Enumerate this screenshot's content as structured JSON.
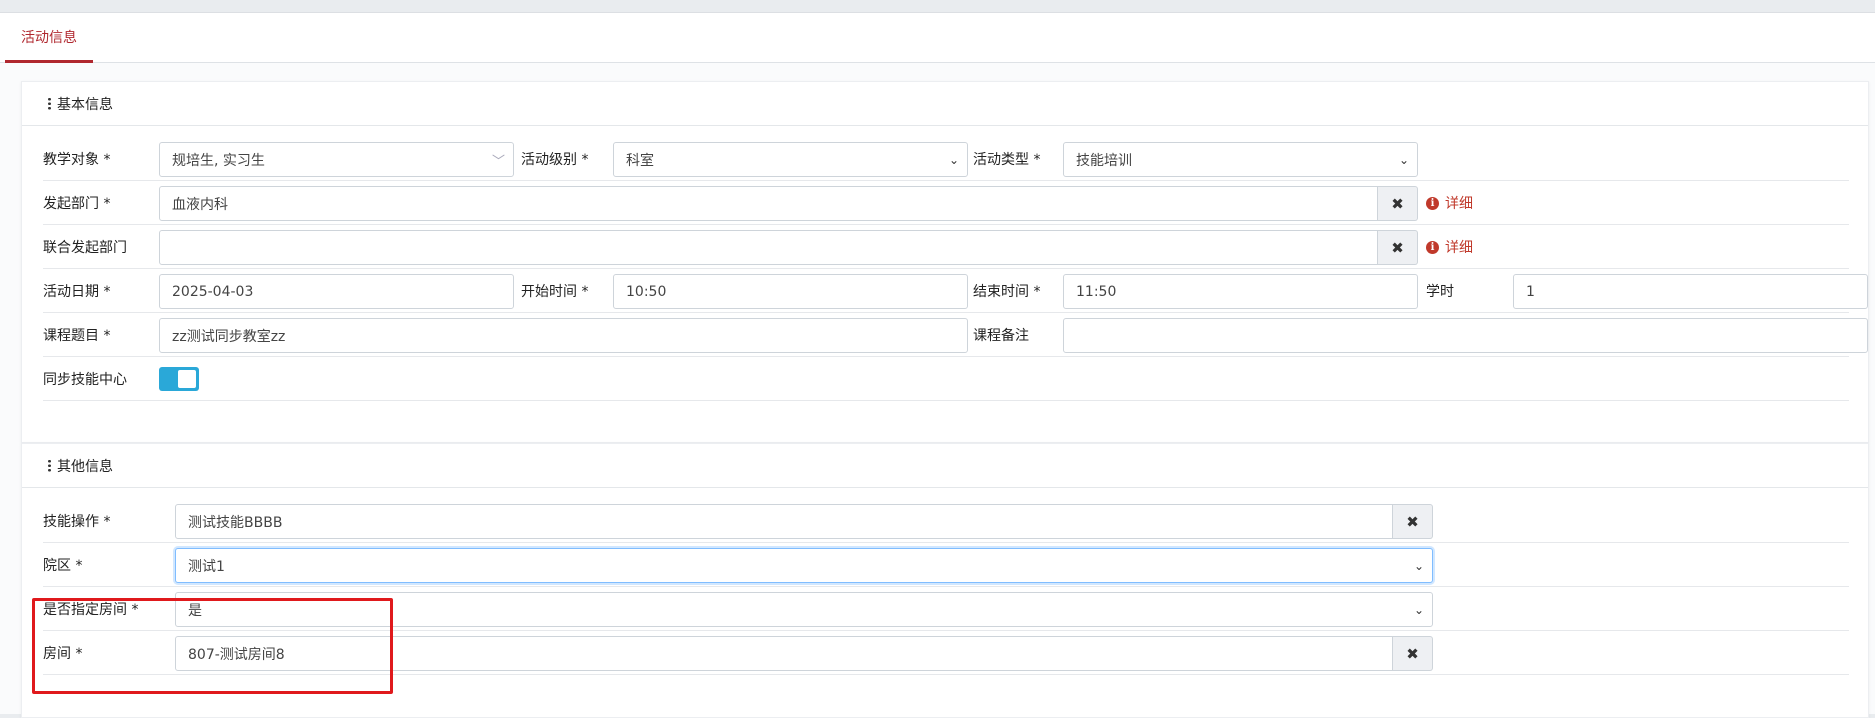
{
  "tabs": {
    "active": "活动信息"
  },
  "basic": {
    "title": "基本信息",
    "teaching_target_label": "教学对象 *",
    "teaching_target_value": "规培生, 实习生",
    "activity_level_label": "活动级别 *",
    "activity_level_value": "科室",
    "activity_type_label": "活动类型 *",
    "activity_type_value": "技能培训",
    "dept_label": "发起部门 *",
    "dept_value": "血液内科",
    "joint_dept_label": "联合发起部门",
    "joint_dept_value": "",
    "detail_label": "详细",
    "date_label": "活动日期 *",
    "date_value": "2025-04-03",
    "start_label": "开始时间 *",
    "start_value": "10:50",
    "end_label": "结束时间 *",
    "end_value": "11:50",
    "hours_label": "学时",
    "hours_value": "1",
    "course_label": "课程题目 *",
    "course_value": "zz测试同步教室zz",
    "remark_label": "课程备注",
    "remark_value": "",
    "sync_label": "同步技能中心",
    "sync_on": true
  },
  "other": {
    "title": "其他信息",
    "skill_label": "技能操作 *",
    "skill_value": "测试技能BBBB",
    "campus_label": "院区 *",
    "campus_value": "测试1",
    "specify_room_label": "是否指定房间 *",
    "specify_room_value": "是",
    "room_label": "房间 *",
    "room_value": "807-测试房间8"
  },
  "colors": {
    "accent": "#b0282f",
    "toggle": "#2aa8d8",
    "highlight": "#e0191c",
    "detail": "#c0392b"
  },
  "icons": {
    "clear": "close-icon",
    "info": "info-icon",
    "dropdown": "chevron-down-icon",
    "section": "vertical-dots-icon"
  }
}
